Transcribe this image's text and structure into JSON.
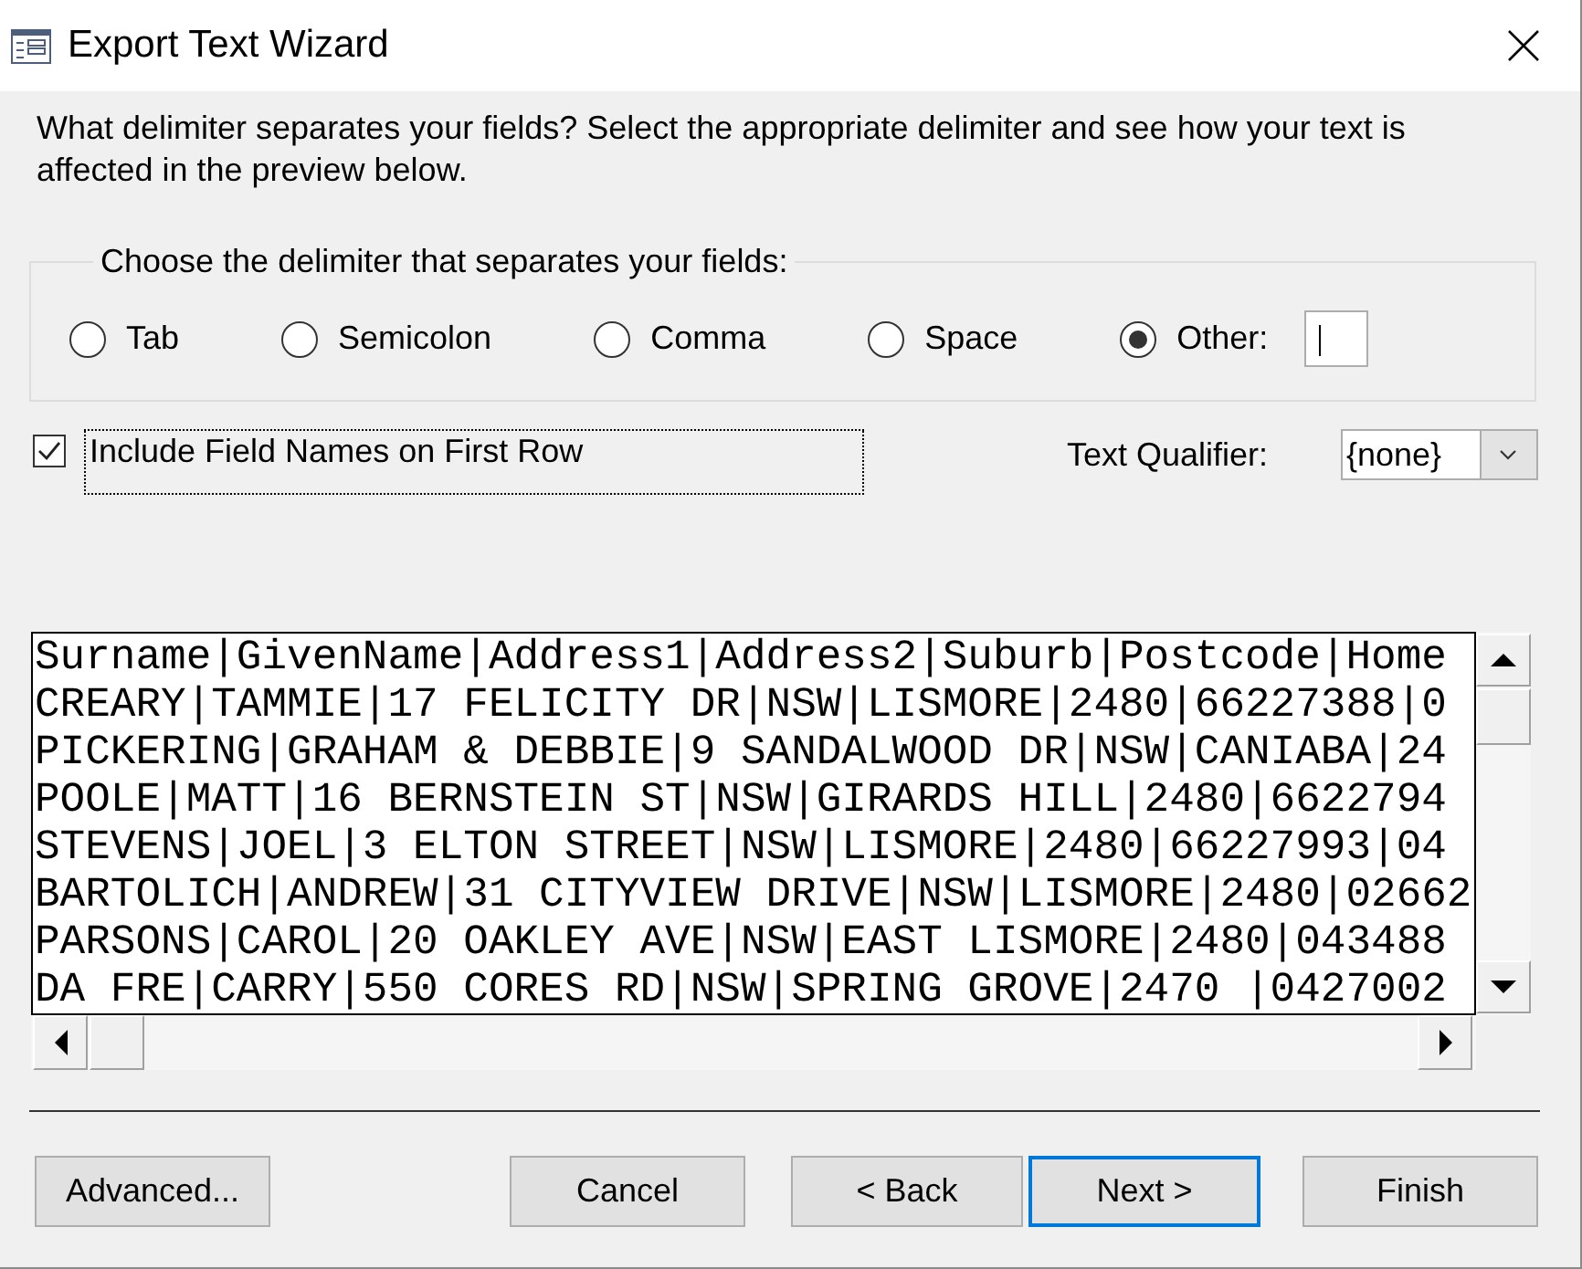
{
  "window": {
    "title": "Export Text Wizard"
  },
  "instruction": "What delimiter separates your fields? Select the appropriate delimiter and see how your text is affected in the preview below.",
  "delimiter_group": {
    "legend": "Choose the delimiter that separates your fields:",
    "options": [
      {
        "label": "Tab",
        "selected": false,
        "kind": "plain"
      },
      {
        "label": "Semicolon",
        "selected": false,
        "kind": "plain"
      },
      {
        "label": "Comma",
        "selected": false,
        "kind": "plain"
      },
      {
        "label": "Space",
        "selected": false,
        "kind": "plain"
      },
      {
        "label": "Other:",
        "selected": true,
        "kind": "with_field",
        "field_focused": true
      }
    ]
  },
  "include_field_names": {
    "label": "Include Field Names on First Row",
    "checked": true,
    "focused": true
  },
  "text_qualifier": {
    "label": "Text Qualifier:",
    "value": "{none}"
  },
  "preview": {
    "lines": [
      "Surname|GivenName|Address1|Address2|Suburb|Postcode|Home",
      "CREARY|TAMMIE|17 FELICITY DR|NSW|LISMORE|2480|66227388|0",
      "PICKERING|GRAHAM & DEBBIE|9 SANDALWOOD DR|NSW|CANIABA|24",
      "POOLE|MATT|16 BERNSTEIN ST|NSW|GIRARDS HILL|2480|6622794",
      "STEVENS|JOEL|3 ELTON STREET|NSW|LISMORE|2480|66227993|04",
      "BARTOLICH|ANDREW|31 CITYVIEW DRIVE|NSW|LISMORE|2480|02662",
      "PARSONS|CAROL|20 OAKLEY AVE|NSW|EAST LISMORE|2480|043488",
      "DA FRE|CARRY|550 CORES RD|NSW|SPRING GROVE|2470 |0427002"
    ]
  },
  "buttons": [
    {
      "label": "Advanced...",
      "default": false
    },
    {
      "label": "Cancel",
      "default": false
    },
    {
      "label": "< Back",
      "default": false
    },
    {
      "label": "Next >",
      "default": true
    },
    {
      "label": "Finish",
      "default": false
    }
  ]
}
